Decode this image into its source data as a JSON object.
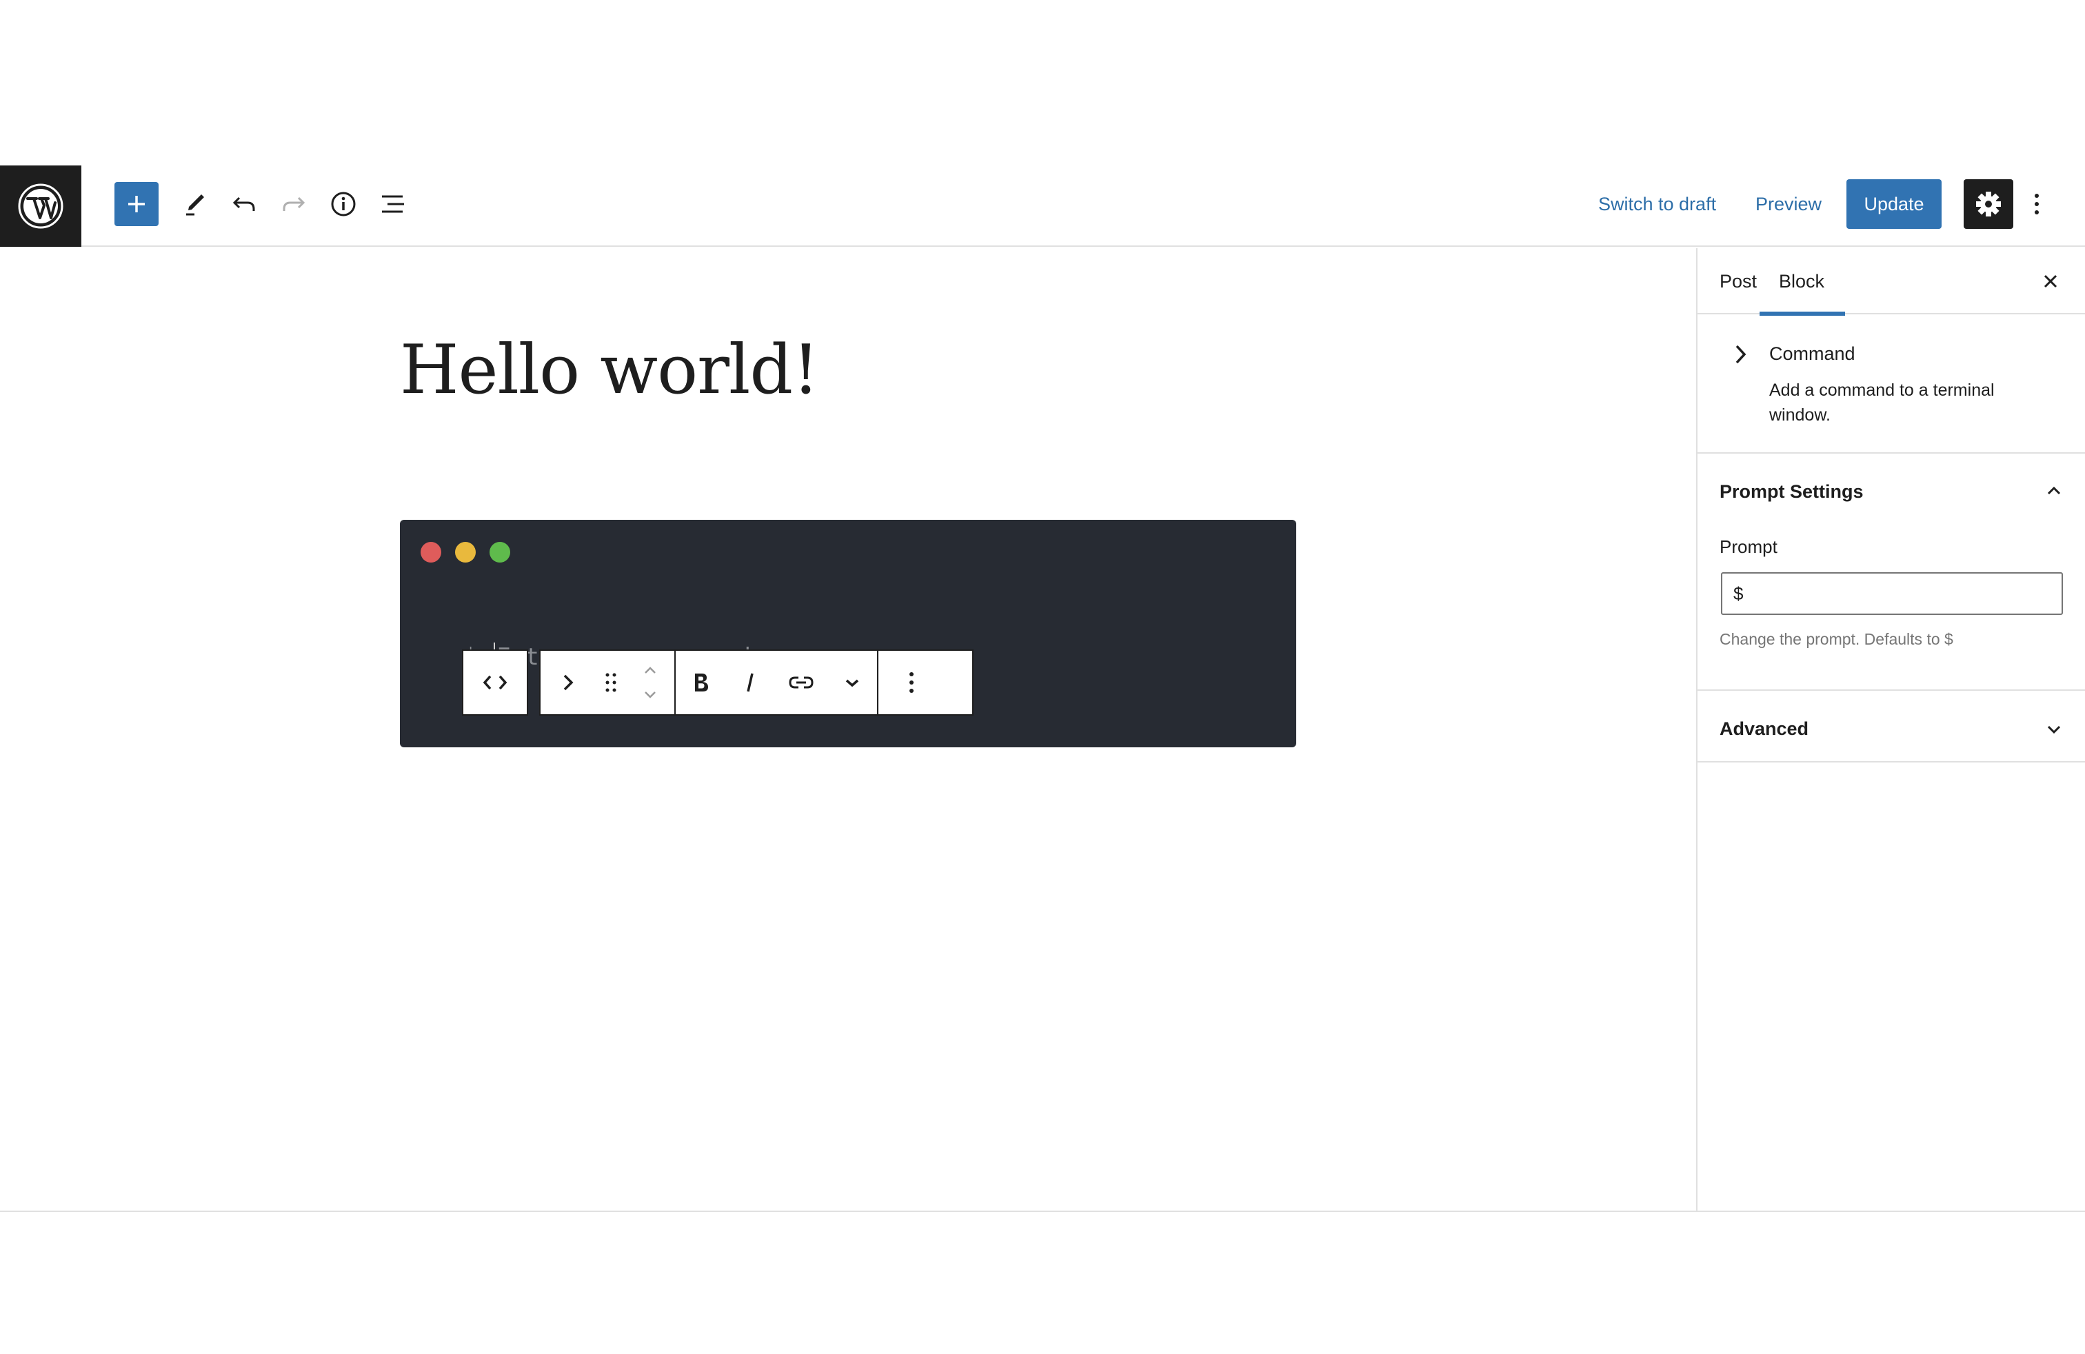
{
  "header": {
    "switch_to_draft": "Switch to draft",
    "preview": "Preview",
    "update": "Update"
  },
  "icons": {
    "logo": "wordpress-logo",
    "add": "plus-icon",
    "tools": "pencil-icon",
    "undo": "undo-icon",
    "redo": "redo-icon",
    "details": "info-icon",
    "list_view": "list-view-icon",
    "settings": "gear-icon",
    "options": "more-vertical-icon"
  },
  "post": {
    "title": "Hello world!"
  },
  "terminal": {
    "prompt": "$",
    "placeholder": "Enter your command...",
    "window_dots": [
      "#df5c5b",
      "#e9b93d",
      "#5fbb4c"
    ],
    "background": "#272b33"
  },
  "block_toolbar": {
    "items": [
      "code-icon",
      "chevron-right-icon",
      "drag-handle-icon",
      "move-up-down-icon",
      "bold-icon",
      "italic-icon",
      "link-icon",
      "chevron-down-icon",
      "more-vertical-icon"
    ]
  },
  "sidebar": {
    "tabs": {
      "post": "Post",
      "block": "Block"
    },
    "block_card": {
      "name": "Command",
      "description": "Add a command to a terminal window."
    },
    "prompt_panel": {
      "title": "Prompt Settings",
      "field_label": "Prompt",
      "field_value": "$",
      "help": "Change the prompt. Defaults to $"
    },
    "advanced_panel": {
      "title": "Advanced"
    }
  },
  "colors": {
    "accent": "#3173b2",
    "dark": "#1e1e1e"
  }
}
